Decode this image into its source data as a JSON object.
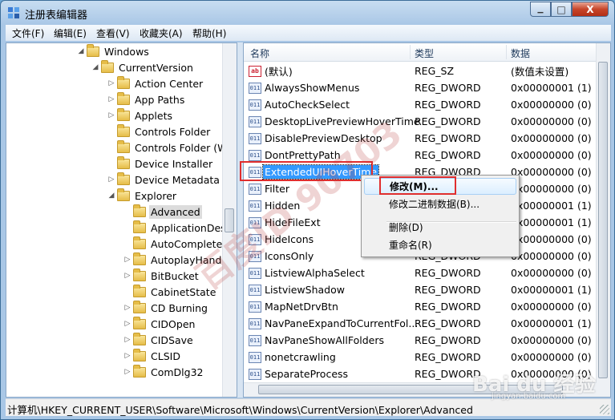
{
  "window": {
    "title": "注册表编辑器",
    "close_glyph": "X",
    "min_glyph": "▁",
    "max_glyph": "□"
  },
  "menu": [
    "文件(F)",
    "编辑(E)",
    "查看(V)",
    "收藏夹(A)",
    "帮助(H)"
  ],
  "tree": [
    {
      "label": "Windows",
      "indent": 0,
      "expanded": true,
      "selected": false
    },
    {
      "label": "CurrentVersion",
      "indent": 1,
      "expanded": true,
      "selected": false
    },
    {
      "label": "Action Center",
      "indent": 2,
      "expanded": false,
      "selected": false
    },
    {
      "label": "App Paths",
      "indent": 2,
      "expanded": false,
      "selected": false
    },
    {
      "label": "Applets",
      "indent": 2,
      "expanded": false,
      "selected": false
    },
    {
      "label": "Controls Folder",
      "indent": 2,
      "expanded": null,
      "selected": false
    },
    {
      "label": "Controls Folder (Wo",
      "indent": 2,
      "expanded": null,
      "selected": false
    },
    {
      "label": "Device Installer",
      "indent": 2,
      "expanded": null,
      "selected": false
    },
    {
      "label": "Device Metadata",
      "indent": 2,
      "expanded": false,
      "selected": false
    },
    {
      "label": "Explorer",
      "indent": 2,
      "expanded": true,
      "selected": false
    },
    {
      "label": "Advanced",
      "indent": 3,
      "expanded": null,
      "selected": true
    },
    {
      "label": "ApplicationDestin",
      "indent": 3,
      "expanded": null,
      "selected": false
    },
    {
      "label": "AutoComplete",
      "indent": 3,
      "expanded": null,
      "selected": false
    },
    {
      "label": "AutoplayHandle",
      "indent": 3,
      "expanded": false,
      "selected": false
    },
    {
      "label": "BitBucket",
      "indent": 3,
      "expanded": false,
      "selected": false
    },
    {
      "label": "CabinetState",
      "indent": 3,
      "expanded": null,
      "selected": false
    },
    {
      "label": "CD Burning",
      "indent": 3,
      "expanded": false,
      "selected": false
    },
    {
      "label": "CIDOpen",
      "indent": 3,
      "expanded": false,
      "selected": false
    },
    {
      "label": "CIDSave",
      "indent": 3,
      "expanded": false,
      "selected": false
    },
    {
      "label": "CLSID",
      "indent": 3,
      "expanded": false,
      "selected": false
    },
    {
      "label": "ComDlg32",
      "indent": 3,
      "expanded": false,
      "selected": false
    }
  ],
  "columns": {
    "name": "名称",
    "type": "类型",
    "data": "数据"
  },
  "values": [
    {
      "icon": "ab",
      "name": "(默认)",
      "type": "REG_SZ",
      "data": "(数值未设置)",
      "selected": false
    },
    {
      "icon": "bin",
      "name": "AlwaysShowMenus",
      "type": "REG_DWORD",
      "data": "0x00000001 (1)",
      "selected": false
    },
    {
      "icon": "bin",
      "name": "AutoCheckSelect",
      "type": "REG_DWORD",
      "data": "0x00000000 (0)",
      "selected": false
    },
    {
      "icon": "bin",
      "name": "DesktopLivePreviewHoverTime",
      "type": "REG_DWORD",
      "data": "0x00000000 (0)",
      "selected": false
    },
    {
      "icon": "bin",
      "name": "DisablePreviewDesktop",
      "type": "REG_DWORD",
      "data": "0x00000000 (0)",
      "selected": false
    },
    {
      "icon": "bin",
      "name": "DontPrettyPath",
      "type": "REG_DWORD",
      "data": "0x00000000 (0)",
      "selected": false
    },
    {
      "icon": "bin",
      "name": "ExtendedUIHoverTime",
      "type": "REG_DWORD",
      "data": "0x00000000 (0)",
      "selected": true
    },
    {
      "icon": "bin",
      "name": "Filter",
      "type": "REG_DWORD",
      "data": "0x00000000 (0)",
      "selected": false
    },
    {
      "icon": "bin",
      "name": "Hidden",
      "type": "REG_DWORD",
      "data": "0x00000001 (1)",
      "selected": false
    },
    {
      "icon": "bin",
      "name": "HideFileExt",
      "type": "REG_DWORD",
      "data": "0x00000001 (1)",
      "selected": false
    },
    {
      "icon": "bin",
      "name": "HideIcons",
      "type": "REG_DWORD",
      "data": "0x00000000 (0)",
      "selected": false
    },
    {
      "icon": "bin",
      "name": "IconsOnly",
      "type": "REG_DWORD",
      "data": "0x00000000 (0)",
      "selected": false
    },
    {
      "icon": "bin",
      "name": "ListviewAlphaSelect",
      "type": "REG_DWORD",
      "data": "0x00000000 (0)",
      "selected": false
    },
    {
      "icon": "bin",
      "name": "ListviewShadow",
      "type": "REG_DWORD",
      "data": "0x00000001 (1)",
      "selected": false
    },
    {
      "icon": "bin",
      "name": "MapNetDrvBtn",
      "type": "REG_DWORD",
      "data": "0x00000000 (0)",
      "selected": false
    },
    {
      "icon": "bin",
      "name": "NavPaneExpandToCurrentFol...",
      "type": "REG_DWORD",
      "data": "0x00000001 (1)",
      "selected": false
    },
    {
      "icon": "bin",
      "name": "NavPaneShowAllFolders",
      "type": "REG_DWORD",
      "data": "0x00000000 (0)",
      "selected": false
    },
    {
      "icon": "bin",
      "name": "nonetcrawling",
      "type": "REG_DWORD",
      "data": "0x00000000 (0)",
      "selected": false
    },
    {
      "icon": "bin",
      "name": "SeparateProcess",
      "type": "REG_DWORD",
      "data": "0x00000000 (0)",
      "selected": false
    }
  ],
  "context_menu": {
    "modify": "修改(M)...",
    "modify_binary": "修改二进制数据(B)...",
    "delete": "删除(D)",
    "rename": "重命名(R)"
  },
  "status": {
    "path": "计算机\\HKEY_CURRENT_USER\\Software\\Microsoft\\Windows\\CurrentVersion\\Explorer\\Advanced"
  },
  "watermark": {
    "text": "百度ID 90703",
    "baidu": "Bai du 经验",
    "site": "jingyan.baidu.com"
  },
  "colors": {
    "selection": "#3399ff",
    "highlight_box": "#e02e2e"
  }
}
